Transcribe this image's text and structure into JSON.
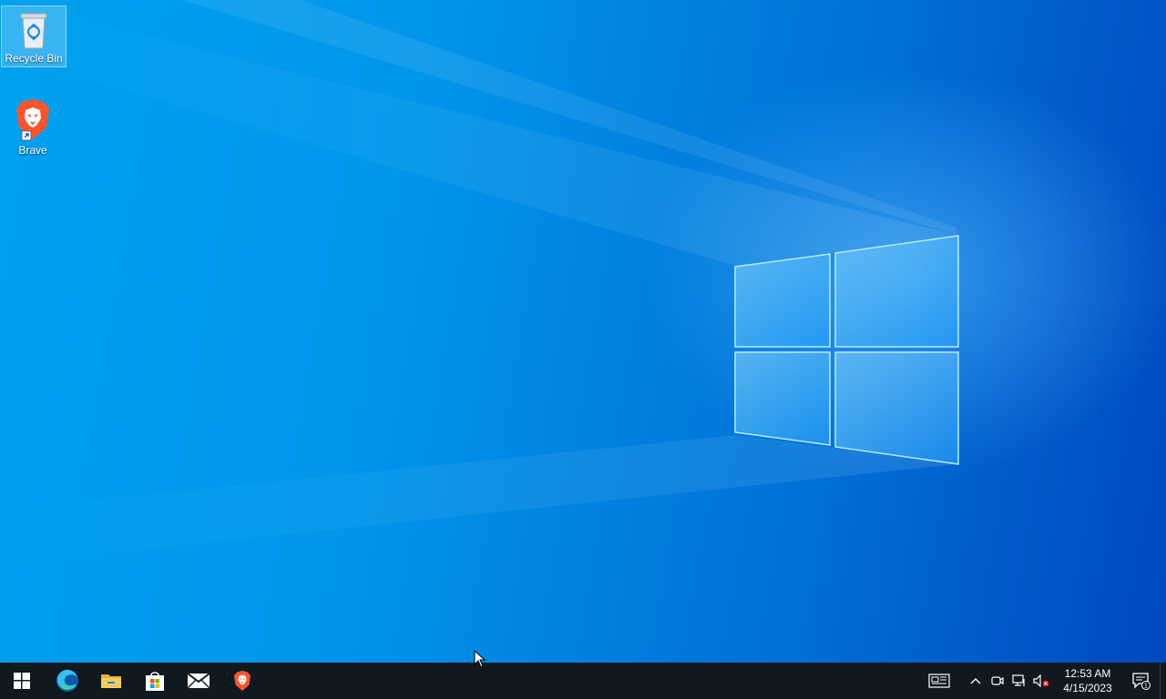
{
  "desktop": {
    "icons": [
      {
        "label": "Recycle Bin",
        "icon": "recycle-bin-icon",
        "selected": true
      },
      {
        "label": "Brave",
        "icon": "brave-lion-icon",
        "shortcut": true
      }
    ]
  },
  "taskbar": {
    "start": {
      "icon": "windows-start-icon"
    },
    "pinned": [
      {
        "name": "Microsoft Edge",
        "icon": "edge-icon"
      },
      {
        "name": "File Explorer",
        "icon": "folder-icon"
      },
      {
        "name": "Microsoft Store",
        "icon": "store-icon"
      },
      {
        "name": "Mail",
        "icon": "mail-icon"
      },
      {
        "name": "Brave",
        "icon": "brave-lion-icon"
      }
    ],
    "tray": {
      "icons": [
        "news-icon",
        "chevron-up-icon",
        "meet-now-icon",
        "network-icon",
        "volume-muted-icon"
      ],
      "time": "12:53 AM",
      "date": "4/15/2023",
      "notification_count": "1"
    }
  },
  "colors": {
    "wallpaper_primary": "#0095ea",
    "wallpaper_dark": "#0048c0",
    "taskbar": "#101820",
    "brave_orange": "#fb542b"
  }
}
